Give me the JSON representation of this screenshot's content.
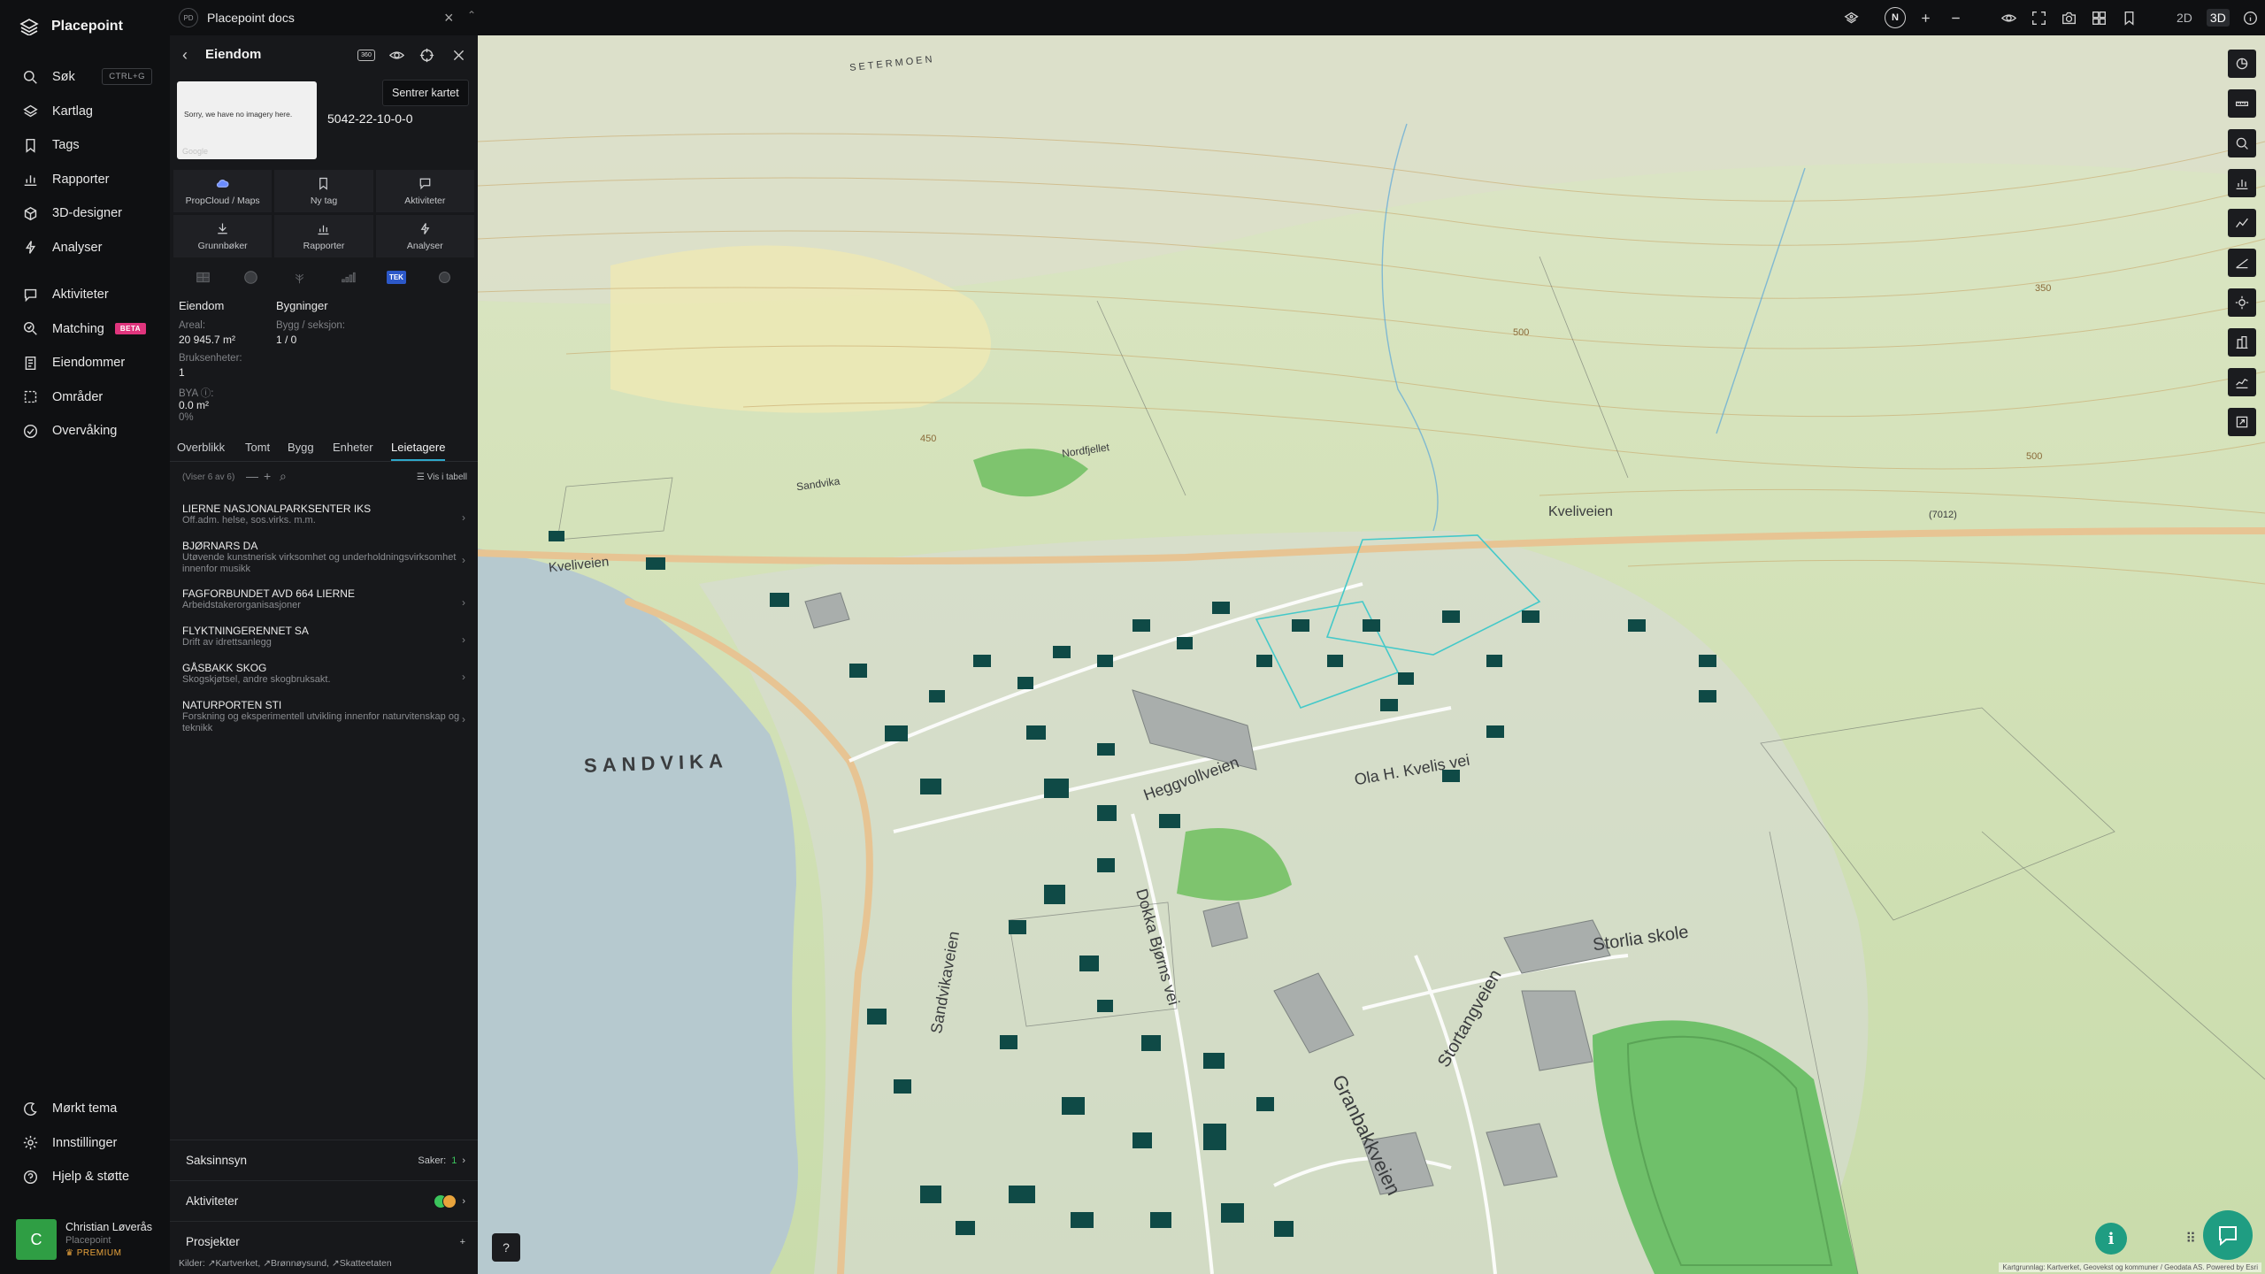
{
  "app": {
    "name": "Placepoint"
  },
  "nav": {
    "search": {
      "label": "Søk",
      "shortcut": "CTRL+G"
    },
    "items_top": [
      {
        "label": "Kartlag"
      },
      {
        "label": "Tags"
      },
      {
        "label": "Rapporter"
      },
      {
        "label": "3D-designer"
      },
      {
        "label": "Analyser"
      }
    ],
    "items_mid": [
      {
        "label": "Aktiviteter"
      },
      {
        "label": "Matching",
        "badge": "BETA"
      },
      {
        "label": "Eiendommer"
      },
      {
        "label": "Områder"
      },
      {
        "label": "Overvåking"
      }
    ],
    "items_bottom": [
      {
        "label": "Mørkt tema"
      },
      {
        "label": "Innstillinger"
      },
      {
        "label": "Hjelp & støtte"
      }
    ],
    "user": {
      "initial": "C",
      "name": "Christian Løverås",
      "org": "Placepoint",
      "plan": "PREMIUM"
    }
  },
  "topbar": {
    "doc_badge": "PD",
    "doc_title": "Placepoint docs",
    "compass": "N",
    "mode_2d": "2D",
    "mode_3d": "3D"
  },
  "panel": {
    "title": "Eiendom",
    "badge_360": "360",
    "tooltip": "Sentrer kartet",
    "thumbnail_text": "Sorry, we have no imagery here.",
    "thumbnail_credit": "Google",
    "property_id": "5042-22-10-0-0",
    "actions": [
      {
        "label": "PropCloud / Maps"
      },
      {
        "label": "Ny tag"
      },
      {
        "label": "Aktiviteter"
      },
      {
        "label": "Grunnbøker"
      },
      {
        "label": "Rapporter"
      },
      {
        "label": "Analyser"
      }
    ],
    "strip_tek": "TEK",
    "facts": {
      "eiendom_head": "Eiendom",
      "bygninger_head": "Bygninger",
      "areal_label": "Areal:",
      "areal_value": "20 945.7 m²",
      "bruksenheter_label": "Bruksenheter:",
      "bruksenheter_value": "1",
      "bya_label": "BYA ⓘ:",
      "bya_value": "0.0 m²",
      "bya_pct": "0%",
      "bygg_label": "Bygg / seksjon:",
      "bygg_value": "1 / 0"
    },
    "tabs": [
      {
        "label": "Overblikk"
      },
      {
        "label": "Tomt"
      },
      {
        "label": "Bygg"
      },
      {
        "label": "Enheter"
      },
      {
        "label": "Leietagere"
      }
    ],
    "list_count": "(Viser 6 av 6)",
    "vis_i_tabell": "Vis i tabell",
    "tenants": [
      {
        "name": "LIERNE NASJONALPARKSENTER IKS",
        "desc": "Off.adm. helse, sos.virks. m.m."
      },
      {
        "name": "BJØRNARS DA",
        "desc": "Utøvende kunstnerisk virksomhet og underholdningsvirksomhet innenfor musikk"
      },
      {
        "name": "FAGFORBUNDET AVD 664 LIERNE",
        "desc": "Arbeidstakerorganisasjoner"
      },
      {
        "name": "FLYKTNINGERENNET SA",
        "desc": "Drift av idrettsanlegg"
      },
      {
        "name": "GÅSBAKK SKOG",
        "desc": "Skogskjøtsel, andre skogbruksakt."
      },
      {
        "name": "NATURPORTEN STI",
        "desc": "Forskning og eksperimentell utvikling innenfor naturvitenskap og teknikk"
      }
    ],
    "saksinnsyn": {
      "label": "Saksinnsyn",
      "count_label": "Saker:",
      "count": "1"
    },
    "aktiviteter": {
      "label": "Aktiviteter"
    },
    "prosjekter": {
      "label": "Prosjekter",
      "add": "+"
    },
    "sources": {
      "label": "Kilder:",
      "items": [
        "Kartverket,",
        "Brønnøysund,",
        "Skatteetaten"
      ]
    }
  },
  "map": {
    "labels": {
      "setermoen": "SETERMOEN",
      "sandvika_small": "Sandvika",
      "nordfjellet": "Nordfjellet",
      "kveliveien_left": "Kveliveien",
      "kveliveien_right": "Kveliveien",
      "road_7012": "(7012)",
      "sandvika_big": "SANDVIKA",
      "heggvollveien": "Heggvollveien",
      "ola_h": "Ola H. Kvelis vei",
      "storlia": "Storlia skole",
      "stortangveien": "Stortangveien",
      "sandvikaveien": "Sandvikaveien",
      "dokka": "Dokka Bjørns vei",
      "granbakk": "Granbakkveien",
      "contour_350": "350",
      "contour_450": "450",
      "contour_500_a": "500",
      "contour_500_b": "500"
    },
    "help_icon": "?",
    "info_icon": "i",
    "attribution": "Kartgrunnlag: Kartverket, Geovekst og kommuner / Geodata AS. Powered by Esri"
  },
  "colors": {
    "accent_teal": "#1f9d82",
    "tab_underline": "#2ea7c9",
    "beta_pink": "#e0357d",
    "lake": "#b6c9cf",
    "forest": "#cfe0b4",
    "building": "#0f4a46"
  }
}
